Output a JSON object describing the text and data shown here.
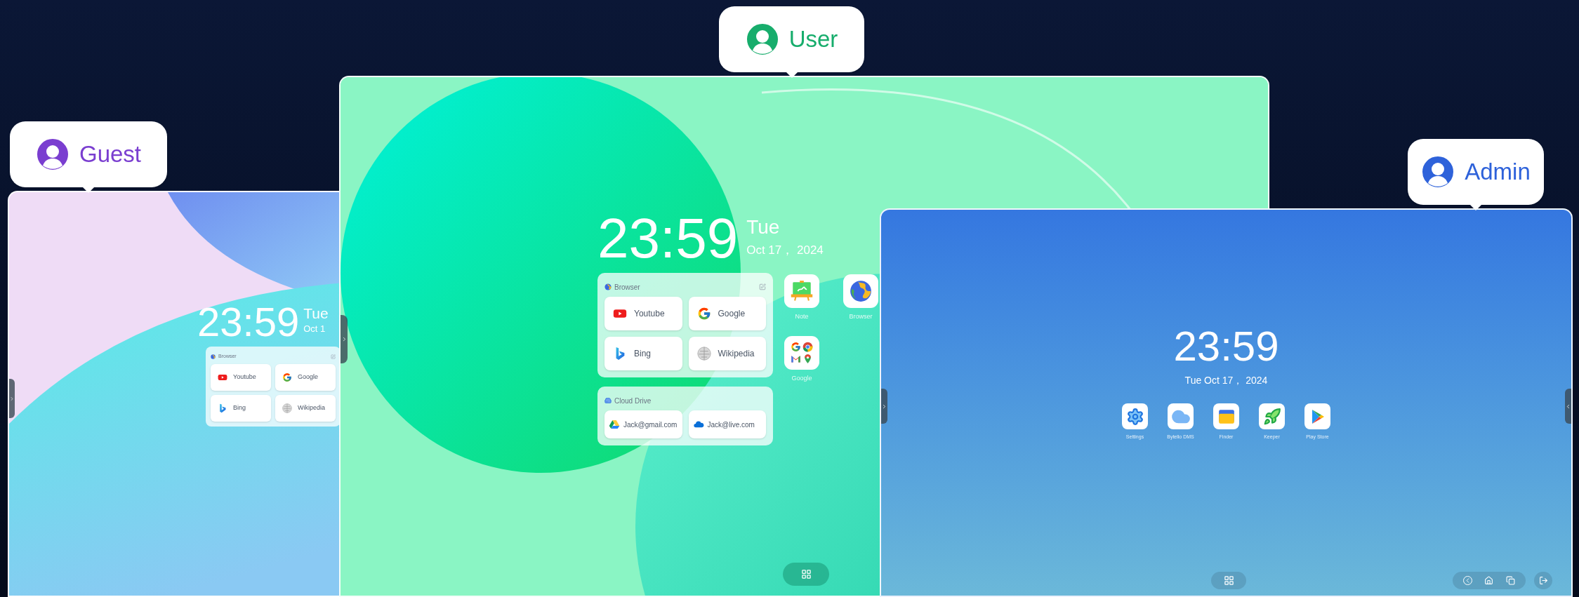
{
  "profiles": [
    {
      "kind": "guest",
      "label": "Guest",
      "color": "#7a3ed0",
      "screen": {
        "time": "23:59",
        "day": "Tue",
        "date": "Oct 1",
        "widgets": [
          {
            "kind": "browser",
            "title": "Browser",
            "links": [
              {
                "kind": "youtube",
                "label": "Youtube"
              },
              {
                "kind": "google",
                "label": "Google"
              },
              {
                "kind": "bing",
                "label": "Bing"
              },
              {
                "kind": "wikipedia",
                "label": "Wikipedia"
              }
            ]
          }
        ]
      }
    },
    {
      "kind": "user",
      "label": "User",
      "color": "#17ad6c",
      "screen": {
        "time": "23:59",
        "day": "Tue",
        "date": "Oct 17， 2024",
        "widgets": [
          {
            "kind": "browser",
            "title": "Browser",
            "links": [
              {
                "kind": "youtube",
                "label": "Youtube"
              },
              {
                "kind": "google",
                "label": "Google"
              },
              {
                "kind": "bing",
                "label": "Bing"
              },
              {
                "kind": "wikipedia",
                "label": "Wikipedia"
              }
            ]
          },
          {
            "kind": "cloud",
            "title": "Cloud Drive",
            "links": [
              {
                "kind": "gdrive",
                "label": "Jack@gmail.com"
              },
              {
                "kind": "onedrive",
                "label": "Jack@live.com"
              }
            ]
          }
        ],
        "apps": [
          {
            "kind": "note",
            "label": "Note"
          },
          {
            "kind": "browser",
            "label": "Browser"
          },
          {
            "kind": "google",
            "label": "Google"
          }
        ]
      }
    },
    {
      "kind": "admin",
      "label": "Admin",
      "color": "#2e62da",
      "screen": {
        "time": "23:59",
        "date": "Tue Oct 17， 2024",
        "apps": [
          {
            "kind": "settings",
            "label": "Settings"
          },
          {
            "kind": "dms",
            "label": "Bytello DMS"
          },
          {
            "kind": "finder",
            "label": "Finder"
          },
          {
            "kind": "keeper",
            "label": "Keeper"
          },
          {
            "kind": "playstore",
            "label": "Play Store"
          }
        ]
      }
    }
  ]
}
